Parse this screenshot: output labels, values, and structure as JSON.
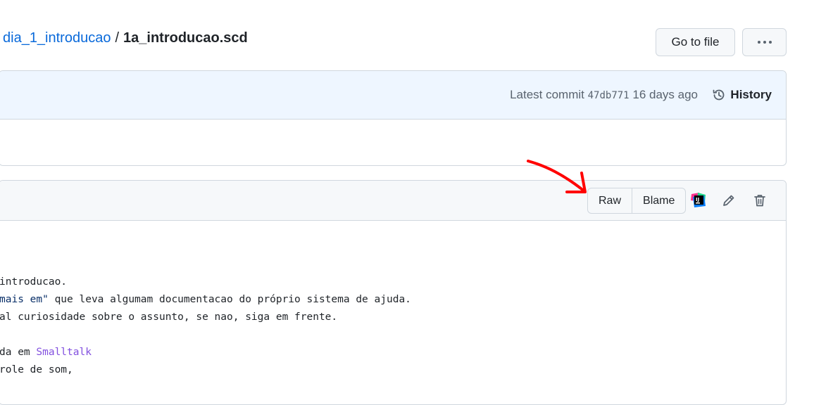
{
  "breadcrumb": {
    "folder": "dia_1_introducao",
    "separator": "/",
    "file": "1a_introducao.scd"
  },
  "header_actions": {
    "go_to_file": "Go to file",
    "more_icon": "kebab-horizontal-icon"
  },
  "commit": {
    "label": "Latest commit",
    "sha": "47db771",
    "age": "16 days ago",
    "history_label": "History",
    "history_icon": "history-icon"
  },
  "file_toolbar": {
    "raw_label": "Raw",
    "blame_label": "Blame",
    "icons": [
      "jetbrains-icon",
      "pencil-icon",
      "trash-icon"
    ]
  },
  "code_lines": {
    "line1": "introducao.",
    "line2_str": "mais em\"",
    "line2_rest": " que leva algumam documentacao do próprio sistema de ajuda.",
    "line3": "al curiosidade sobre o assunto, se nao, siga em frente.",
    "line5_pre": "da em ",
    "line5_cls": "Smalltalk",
    "line6": "role de som,"
  },
  "colors": {
    "link": "#0969da",
    "annotation_arrow": "#ff0000"
  }
}
